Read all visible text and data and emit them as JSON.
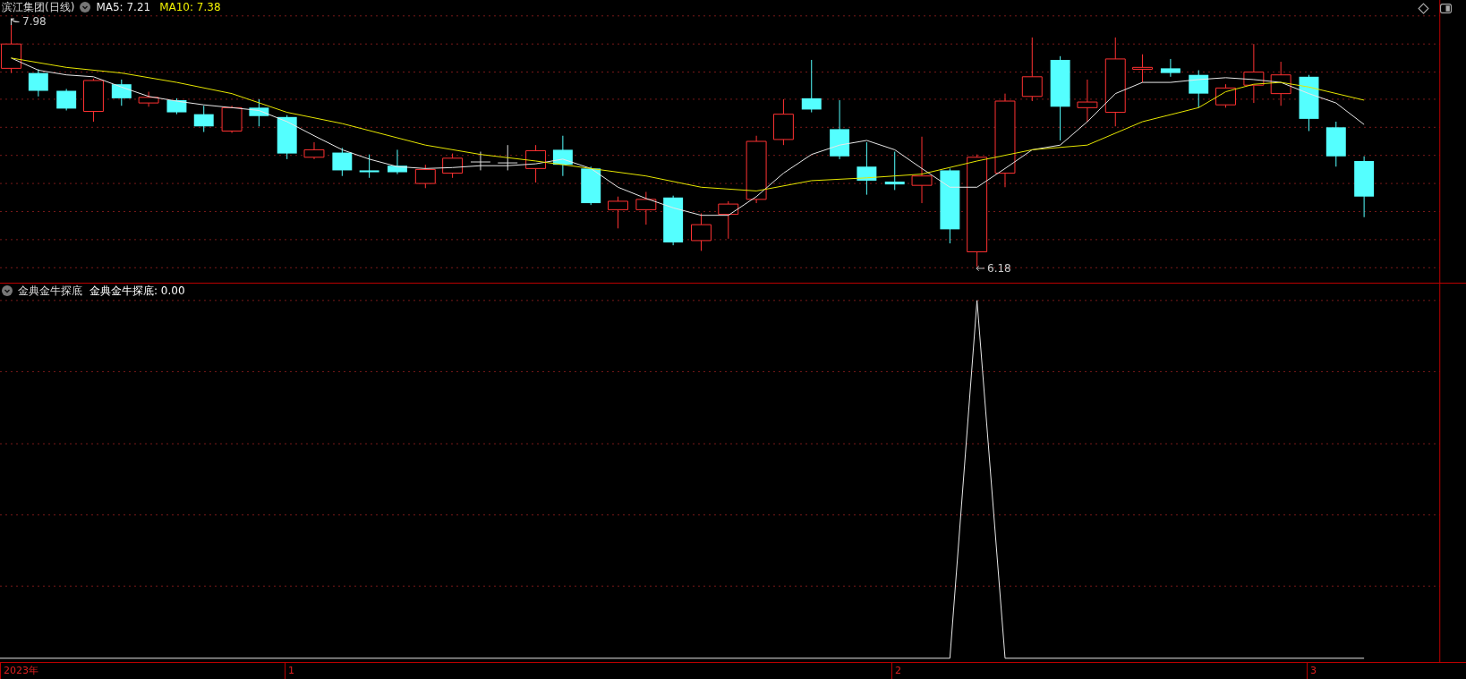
{
  "header": {
    "title": "滨江集团(日线)",
    "ma5": "MA5: 7.21",
    "ma10": "MA10: 7.38"
  },
  "high_label": "7.98",
  "low_label": "6.18",
  "indicator": {
    "name": "金典金牛探底",
    "reading": "金典金牛探底: 0.00"
  },
  "axis_labels": [
    "2023年",
    "1",
    "2",
    "3"
  ]
}
